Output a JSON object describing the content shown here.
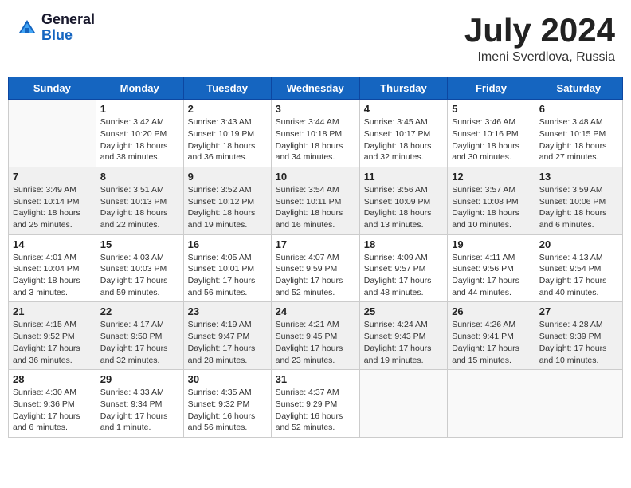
{
  "header": {
    "logo_general": "General",
    "logo_blue": "Blue",
    "month_title": "July 2024",
    "location": "Imeni Sverdlova, Russia"
  },
  "weekdays": [
    "Sunday",
    "Monday",
    "Tuesday",
    "Wednesday",
    "Thursday",
    "Friday",
    "Saturday"
  ],
  "weeks": [
    [
      {
        "day": "",
        "info": ""
      },
      {
        "day": "1",
        "info": "Sunrise: 3:42 AM\nSunset: 10:20 PM\nDaylight: 18 hours\nand 38 minutes."
      },
      {
        "day": "2",
        "info": "Sunrise: 3:43 AM\nSunset: 10:19 PM\nDaylight: 18 hours\nand 36 minutes."
      },
      {
        "day": "3",
        "info": "Sunrise: 3:44 AM\nSunset: 10:18 PM\nDaylight: 18 hours\nand 34 minutes."
      },
      {
        "day": "4",
        "info": "Sunrise: 3:45 AM\nSunset: 10:17 PM\nDaylight: 18 hours\nand 32 minutes."
      },
      {
        "day": "5",
        "info": "Sunrise: 3:46 AM\nSunset: 10:16 PM\nDaylight: 18 hours\nand 30 minutes."
      },
      {
        "day": "6",
        "info": "Sunrise: 3:48 AM\nSunset: 10:15 PM\nDaylight: 18 hours\nand 27 minutes."
      }
    ],
    [
      {
        "day": "7",
        "info": "Sunrise: 3:49 AM\nSunset: 10:14 PM\nDaylight: 18 hours\nand 25 minutes."
      },
      {
        "day": "8",
        "info": "Sunrise: 3:51 AM\nSunset: 10:13 PM\nDaylight: 18 hours\nand 22 minutes."
      },
      {
        "day": "9",
        "info": "Sunrise: 3:52 AM\nSunset: 10:12 PM\nDaylight: 18 hours\nand 19 minutes."
      },
      {
        "day": "10",
        "info": "Sunrise: 3:54 AM\nSunset: 10:11 PM\nDaylight: 18 hours\nand 16 minutes."
      },
      {
        "day": "11",
        "info": "Sunrise: 3:56 AM\nSunset: 10:09 PM\nDaylight: 18 hours\nand 13 minutes."
      },
      {
        "day": "12",
        "info": "Sunrise: 3:57 AM\nSunset: 10:08 PM\nDaylight: 18 hours\nand 10 minutes."
      },
      {
        "day": "13",
        "info": "Sunrise: 3:59 AM\nSunset: 10:06 PM\nDaylight: 18 hours\nand 6 minutes."
      }
    ],
    [
      {
        "day": "14",
        "info": "Sunrise: 4:01 AM\nSunset: 10:04 PM\nDaylight: 18 hours\nand 3 minutes."
      },
      {
        "day": "15",
        "info": "Sunrise: 4:03 AM\nSunset: 10:03 PM\nDaylight: 17 hours\nand 59 minutes."
      },
      {
        "day": "16",
        "info": "Sunrise: 4:05 AM\nSunset: 10:01 PM\nDaylight: 17 hours\nand 56 minutes."
      },
      {
        "day": "17",
        "info": "Sunrise: 4:07 AM\nSunset: 9:59 PM\nDaylight: 17 hours\nand 52 minutes."
      },
      {
        "day": "18",
        "info": "Sunrise: 4:09 AM\nSunset: 9:57 PM\nDaylight: 17 hours\nand 48 minutes."
      },
      {
        "day": "19",
        "info": "Sunrise: 4:11 AM\nSunset: 9:56 PM\nDaylight: 17 hours\nand 44 minutes."
      },
      {
        "day": "20",
        "info": "Sunrise: 4:13 AM\nSunset: 9:54 PM\nDaylight: 17 hours\nand 40 minutes."
      }
    ],
    [
      {
        "day": "21",
        "info": "Sunrise: 4:15 AM\nSunset: 9:52 PM\nDaylight: 17 hours\nand 36 minutes."
      },
      {
        "day": "22",
        "info": "Sunrise: 4:17 AM\nSunset: 9:50 PM\nDaylight: 17 hours\nand 32 minutes."
      },
      {
        "day": "23",
        "info": "Sunrise: 4:19 AM\nSunset: 9:47 PM\nDaylight: 17 hours\nand 28 minutes."
      },
      {
        "day": "24",
        "info": "Sunrise: 4:21 AM\nSunset: 9:45 PM\nDaylight: 17 hours\nand 23 minutes."
      },
      {
        "day": "25",
        "info": "Sunrise: 4:24 AM\nSunset: 9:43 PM\nDaylight: 17 hours\nand 19 minutes."
      },
      {
        "day": "26",
        "info": "Sunrise: 4:26 AM\nSunset: 9:41 PM\nDaylight: 17 hours\nand 15 minutes."
      },
      {
        "day": "27",
        "info": "Sunrise: 4:28 AM\nSunset: 9:39 PM\nDaylight: 17 hours\nand 10 minutes."
      }
    ],
    [
      {
        "day": "28",
        "info": "Sunrise: 4:30 AM\nSunset: 9:36 PM\nDaylight: 17 hours\nand 6 minutes."
      },
      {
        "day": "29",
        "info": "Sunrise: 4:33 AM\nSunset: 9:34 PM\nDaylight: 17 hours\nand 1 minute."
      },
      {
        "day": "30",
        "info": "Sunrise: 4:35 AM\nSunset: 9:32 PM\nDaylight: 16 hours\nand 56 minutes."
      },
      {
        "day": "31",
        "info": "Sunrise: 4:37 AM\nSunset: 9:29 PM\nDaylight: 16 hours\nand 52 minutes."
      },
      {
        "day": "",
        "info": ""
      },
      {
        "day": "",
        "info": ""
      },
      {
        "day": "",
        "info": ""
      }
    ]
  ]
}
